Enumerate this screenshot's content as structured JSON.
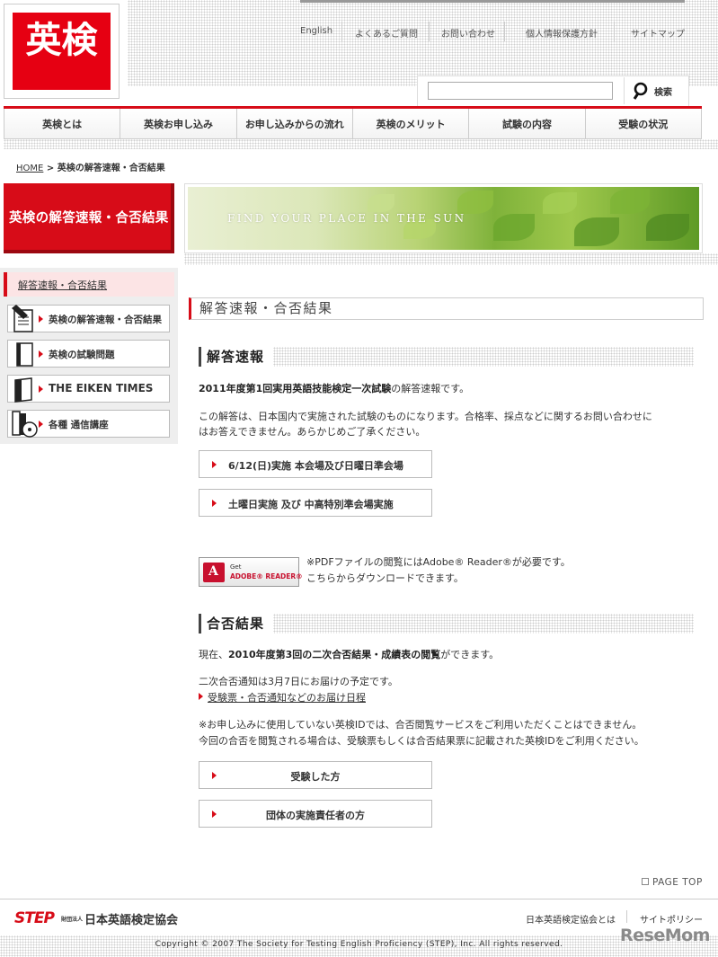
{
  "header": {
    "logo_text": "英検",
    "util_links": [
      "English",
      "よくあるご質問",
      "お問い合わせ",
      "個人情報保護方針",
      "サイトマップ"
    ],
    "search": {
      "placeholder": "",
      "button_label": "検索"
    }
  },
  "nav": {
    "items": [
      "英検とは",
      "英検お申し込み",
      "お申し込みからの流れ",
      "英検のメリット",
      "試験の内容",
      "受験の状況"
    ]
  },
  "breadcrumb": {
    "home": "HOME",
    "separator": ">",
    "current": "英検の解答速報・合否結果"
  },
  "page_title": "英検の解答速報・合否結果",
  "hero_text": "FIND YOUR PLACE IN THE SUN",
  "sidebar": {
    "active": "解答速報・合否結果",
    "items": [
      {
        "label": "英検の解答速報・合否結果",
        "icon": "pencil-icon"
      },
      {
        "label": "英検の試験問題",
        "icon": "book-icon"
      },
      {
        "label": "THE EIKEN TIMES",
        "icon": "newspaper-icon"
      },
      {
        "label": "各種 通信講座",
        "icon": "books-cd-icon"
      }
    ]
  },
  "main": {
    "section_title": "解答速報・合否結果",
    "answers": {
      "heading": "解答速報",
      "intro_bold": "2011年度第1回実用英語技能検定一次試験",
      "intro_rest": "の解答速報です。",
      "note_line1": "この解答は、日本国内で実施された試験のものになります。合格率、採点などに関するお問い合わせに",
      "note_line2": "はお答えできません。あらかじめご了承ください。",
      "buttons": [
        "6/12(日)実施 本会場及び日曜日準会場",
        "土曜日実施 及び 中高特別準会場実施"
      ]
    },
    "adobe": {
      "badge_get": "Get",
      "badge_reader": "ADOBE® READER®",
      "line1": "※PDFファイルの閲覧にはAdobe® Reader®が必要です。",
      "line2": "こちらからダウンロードできます。"
    },
    "results": {
      "heading": "合否結果",
      "line_pre": "現在、",
      "line_bold": "2010年度第3回の二次合否結果・成績表の閲覧",
      "line_post": "ができます。",
      "notice": "二次合否通知は3月7日にお届けの予定です。",
      "link": "受験票・合否通知などのお届け日程",
      "warn1": "※お申し込みに使用していない英検IDでは、合否閲覧サービスをご利用いただくことはできません。",
      "warn2": "今回の合否を閲覧される場合は、受験票もしくは合否結果票に記載された英検IDをご利用ください。",
      "buttons": [
        "受験した方",
        "団体の実施責任者の方"
      ]
    }
  },
  "footer": {
    "page_top": "PAGE TOP",
    "step_logo": "STEP",
    "org_small": "財団法人",
    "org_name": "日本英語検定協会",
    "links": [
      "日本英語検定協会とは",
      "サイトポリシー"
    ],
    "copyright": "Copyright © 2007 The Society for Testing English Proficiency (STEP), Inc. All rights reserved.",
    "watermark": "ReseMom"
  },
  "colors": {
    "brand_red": "#d70c18",
    "active_bg": "#fce4e5"
  }
}
